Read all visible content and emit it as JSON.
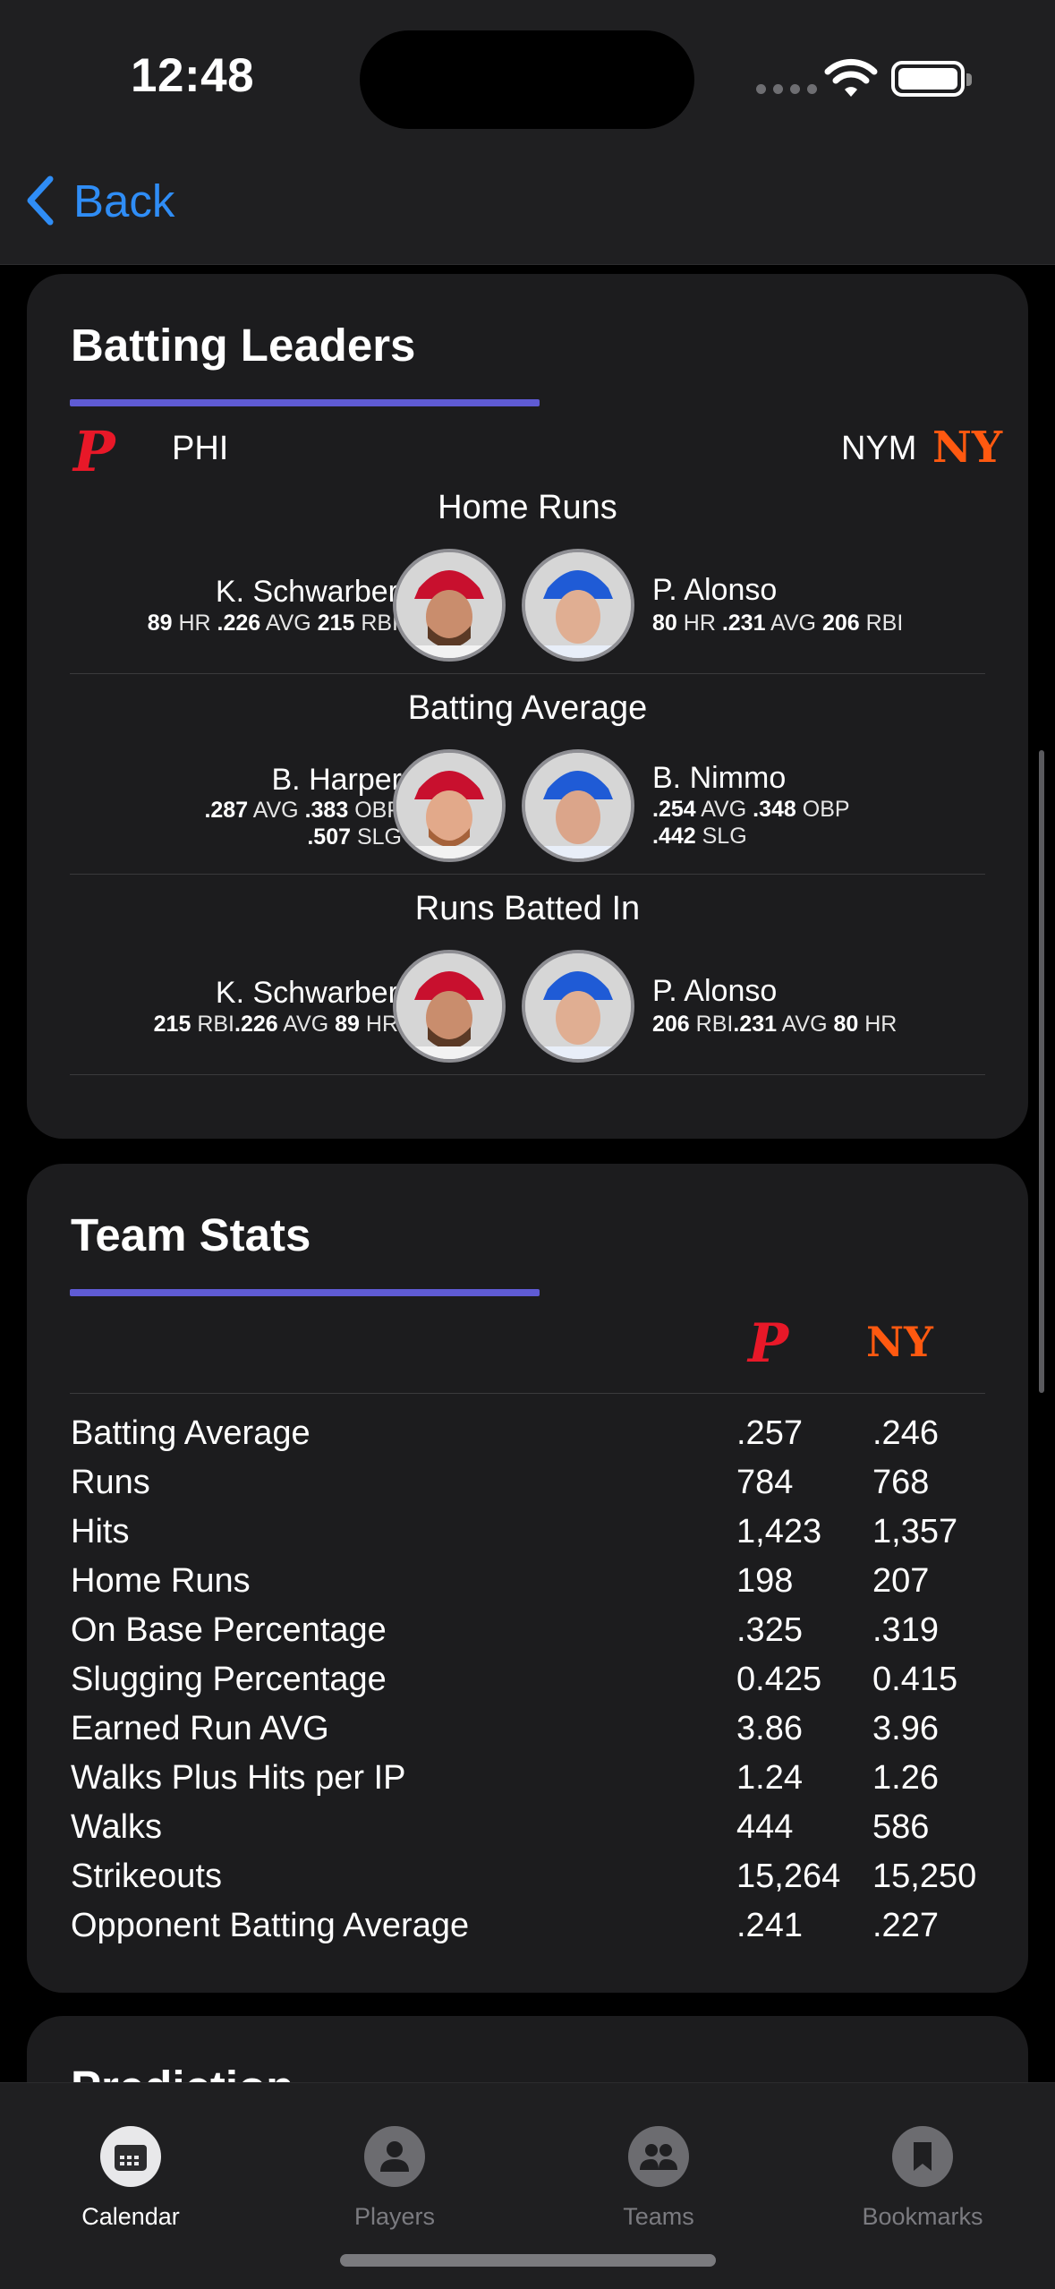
{
  "status_bar": {
    "time": "12:48"
  },
  "nav": {
    "back_label": "Back"
  },
  "batting_leaders": {
    "title": "Batting Leaders",
    "home_team": {
      "abbr": "PHI",
      "logo_letter": "P",
      "color": "#e81828"
    },
    "away_team": {
      "abbr": "NYM",
      "logo_letter": "NY",
      "color": "#ff5910"
    },
    "sections": [
      {
        "title": "Home Runs",
        "home": {
          "name": "K. Schwarber",
          "stats": [
            [
              "89",
              " HR "
            ],
            [
              ".226",
              " AVG "
            ],
            [
              "215",
              " RBI"
            ]
          ]
        },
        "away": {
          "name": "P. Alonso",
          "stats": [
            [
              "80",
              " HR "
            ],
            [
              ".231",
              " AVG "
            ],
            [
              "206",
              " RBI"
            ]
          ]
        }
      },
      {
        "title": "Batting Average",
        "home": {
          "name": "B. Harper",
          "line1": [
            [
              ".287",
              " AVG "
            ],
            [
              ".383",
              " OBP"
            ]
          ],
          "line2": [
            [
              ".507",
              " SLG"
            ]
          ]
        },
        "away": {
          "name": "B. Nimmo",
          "line1": [
            [
              ".254",
              " AVG "
            ],
            [
              ".348",
              " OBP"
            ]
          ],
          "line2": [
            [
              ".442",
              " SLG"
            ]
          ]
        }
      },
      {
        "title": "Runs Batted In",
        "home": {
          "name": "K. Schwarber",
          "stats": [
            [
              "215",
              " RBI"
            ],
            [
              ".226",
              " AVG "
            ],
            [
              "89",
              " HR"
            ]
          ]
        },
        "away": {
          "name": "P. Alonso",
          "stats": [
            [
              "206",
              " RBI"
            ],
            [
              ".231",
              " AVG "
            ],
            [
              "80",
              " HR"
            ]
          ]
        }
      }
    ]
  },
  "team_stats": {
    "title": "Team Stats",
    "rows": [
      {
        "label": "Batting Average",
        "phi": ".257",
        "nym": ".246"
      },
      {
        "label": "Runs",
        "phi": "784",
        "nym": "768"
      },
      {
        "label": "Hits",
        "phi": "1,423",
        "nym": "1,357"
      },
      {
        "label": "Home Runs",
        "phi": "198",
        "nym": "207"
      },
      {
        "label": "On Base Percentage",
        "phi": ".325",
        "nym": ".319"
      },
      {
        "label": "Slugging Percentage",
        "phi": "0.425",
        "nym": "0.415"
      },
      {
        "label": "Earned Run AVG",
        "phi": "3.86",
        "nym": "3.96"
      },
      {
        "label": "Walks Plus Hits per IP",
        "phi": "1.24",
        "nym": "1.26"
      },
      {
        "label": "Walks",
        "phi": "444",
        "nym": "586"
      },
      {
        "label": "Strikeouts",
        "phi": "15,264",
        "nym": "15,250"
      },
      {
        "label": "Opponent Batting Average",
        "phi": ".241",
        "nym": ".227"
      }
    ]
  },
  "prediction": {
    "title": "Prediction"
  },
  "tab_bar": {
    "tabs": [
      {
        "label": "Calendar",
        "icon": "calendar-icon",
        "active": true
      },
      {
        "label": "Players",
        "icon": "person-icon",
        "active": false
      },
      {
        "label": "Teams",
        "icon": "people-icon",
        "active": false
      },
      {
        "label": "Bookmarks",
        "icon": "bookmark-icon",
        "active": false
      }
    ]
  }
}
